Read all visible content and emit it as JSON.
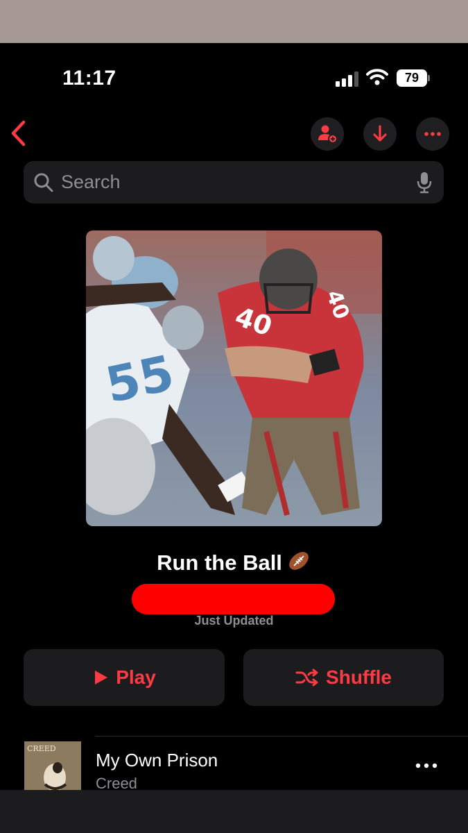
{
  "status_bar": {
    "time": "11:17",
    "battery": "79"
  },
  "header": {
    "back_icon": "chevron-left-icon",
    "actions": [
      "add-person-icon",
      "download-icon",
      "more-icon"
    ]
  },
  "search": {
    "placeholder": "Search"
  },
  "playlist": {
    "title": "Run the Ball",
    "title_emoji": "football-icon",
    "subtitle": "Just Updated"
  },
  "buttons": {
    "play": "Play",
    "shuffle": "Shuffle"
  },
  "tracks": [
    {
      "title": "My Own Prison",
      "artist": "Creed",
      "art_label": "CREED"
    }
  ],
  "colors": {
    "accent": "#fc3c44",
    "background": "#000000",
    "control_bg": "#1c1c1e"
  }
}
